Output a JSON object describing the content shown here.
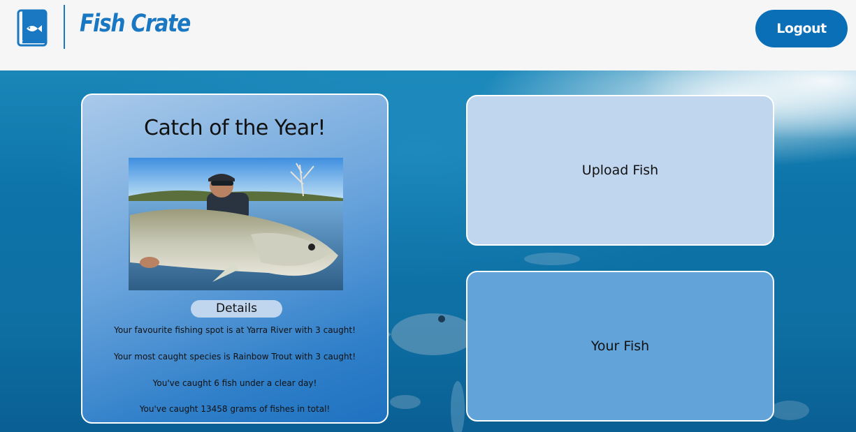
{
  "header": {
    "brand": "Fish Crate",
    "logout_label": "Logout"
  },
  "icons": {
    "logo": "fish-book-icon"
  },
  "colors": {
    "brand_blue": "#1a78c2",
    "logout_bg": "#0b6fb8",
    "upload_card_bg": "#c0d6ee",
    "your_fish_card_bg": "#62a3da"
  },
  "catch_card": {
    "title": "Catch of the Year!",
    "details_label": "Details",
    "stats": [
      "Your favourite fishing spot is at Yarra River with 3 caught!",
      "Your most caught species is Rainbow Trout with 3 caught!",
      "You've caught 6 fish under a clear day!",
      "You've caught 13458 grams of fishes in total!"
    ]
  },
  "actions": {
    "upload_label": "Upload Fish",
    "your_fish_label": "Your Fish"
  }
}
